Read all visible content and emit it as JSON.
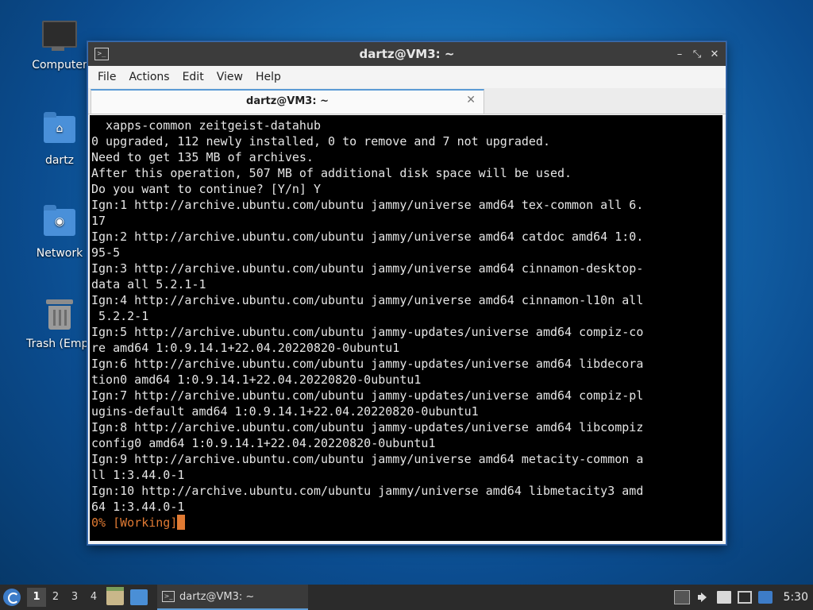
{
  "desktop": {
    "icons": [
      {
        "label": "Computer",
        "icon": "computer-icon"
      },
      {
        "label": "dartz",
        "icon": "home-folder-icon"
      },
      {
        "label": "Network",
        "icon": "network-folder-icon"
      },
      {
        "label": "Trash (Empt",
        "icon": "trash-icon"
      }
    ]
  },
  "window": {
    "title": "dartz@VM3: ~",
    "app_icon": "terminal-icon",
    "controls": [
      "minimize",
      "maximize",
      "close"
    ],
    "menu": [
      "File",
      "Actions",
      "Edit",
      "View",
      "Help"
    ],
    "tab": {
      "label": "dartz@VM3: ~",
      "close_glyph": "✕"
    },
    "terminal": {
      "lines": [
        "  xapps-common zeitgeist-datahub",
        "0 upgraded, 112 newly installed, 0 to remove and 7 not upgraded.",
        "Need to get 135 MB of archives.",
        "After this operation, 507 MB of additional disk space will be used.",
        "Do you want to continue? [Y/n] Y",
        "Ign:1 http://archive.ubuntu.com/ubuntu jammy/universe amd64 tex-common all 6.",
        "17",
        "Ign:2 http://archive.ubuntu.com/ubuntu jammy/universe amd64 catdoc amd64 1:0.",
        "95-5",
        "Ign:3 http://archive.ubuntu.com/ubuntu jammy/universe amd64 cinnamon-desktop-",
        "data all 5.2.1-1",
        "Ign:4 http://archive.ubuntu.com/ubuntu jammy/universe amd64 cinnamon-l10n all",
        " 5.2.2-1",
        "Ign:5 http://archive.ubuntu.com/ubuntu jammy-updates/universe amd64 compiz-co",
        "re amd64 1:0.9.14.1+22.04.20220820-0ubuntu1",
        "Ign:6 http://archive.ubuntu.com/ubuntu jammy-updates/universe amd64 libdecora",
        "tion0 amd64 1:0.9.14.1+22.04.20220820-0ubuntu1",
        "Ign:7 http://archive.ubuntu.com/ubuntu jammy-updates/universe amd64 compiz-pl",
        "ugins-default amd64 1:0.9.14.1+22.04.20220820-0ubuntu1",
        "Ign:8 http://archive.ubuntu.com/ubuntu jammy-updates/universe amd64 libcompiz",
        "config0 amd64 1:0.9.14.1+22.04.20220820-0ubuntu1",
        "Ign:9 http://archive.ubuntu.com/ubuntu jammy/universe amd64 metacity-common a",
        "ll 1:3.44.0-1",
        "Ign:10 http://archive.ubuntu.com/ubuntu jammy/universe amd64 libmetacity3 amd",
        "64 1:3.44.0-1"
      ],
      "status_line": "0% [Working]",
      "status_color": "#e07a33"
    }
  },
  "taskbar": {
    "start_icon": "lubuntu-menu-icon",
    "workspaces": [
      "1",
      "2",
      "3",
      "4"
    ],
    "active_workspace": "1",
    "launchers": [
      "file-manager-icon",
      "show-desktop-icon"
    ],
    "task": {
      "label": "dartz@VM3: ~",
      "icon": "terminal-icon"
    },
    "tray": [
      "tray-arrow-icon",
      "volume-icon",
      "clipboard-icon",
      "network-icon",
      "update-notifier-icon"
    ],
    "clock": "5:30"
  }
}
